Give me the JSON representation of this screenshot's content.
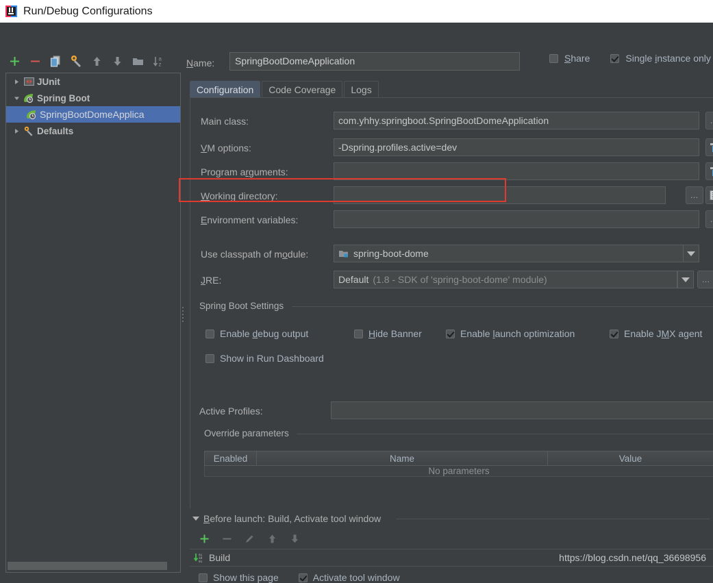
{
  "window": {
    "title": "Run/Debug Configurations",
    "logo_icon": "intellij-idea-logo"
  },
  "toolbar": {
    "buttons": [
      {
        "name": "add",
        "icon": "plus-icon",
        "label": "+"
      },
      {
        "name": "remove",
        "icon": "minus-icon",
        "label": "−"
      },
      {
        "name": "copy",
        "icon": "copy-icon",
        "label": ""
      },
      {
        "name": "edit-templates",
        "icon": "wrench-icon",
        "label": ""
      },
      {
        "name": "move-up",
        "icon": "arrow-up-icon",
        "label": ""
      },
      {
        "name": "move-down",
        "icon": "arrow-down-icon",
        "label": ""
      },
      {
        "name": "new-folder",
        "icon": "folder-icon",
        "label": ""
      },
      {
        "name": "sort-alphabetically",
        "icon": "sort-az-icon",
        "label": ""
      }
    ]
  },
  "tree": {
    "items": [
      {
        "label": "JUnit",
        "icon": "junit-icon",
        "expanded": false,
        "selected": false,
        "child": false
      },
      {
        "label": "Spring Boot",
        "icon": "spring-boot-icon",
        "expanded": true,
        "selected": false,
        "child": false
      },
      {
        "label": "SpringBootDomeApplica",
        "icon": "spring-boot-icon",
        "expanded": null,
        "selected": true,
        "child": true
      },
      {
        "label": "Defaults",
        "icon": "wrench-icon",
        "expanded": false,
        "selected": false,
        "child": false
      }
    ]
  },
  "header": {
    "name_label": "Name:",
    "name_value": "SpringBootDomeApplication",
    "share_label": "Share",
    "share_checked": false,
    "single_instance_label": "Single instance only",
    "single_instance_checked": true
  },
  "tabs": [
    {
      "label": "Configuration",
      "active": true
    },
    {
      "label": "Code Coverage",
      "active": false
    },
    {
      "label": "Logs",
      "active": false
    }
  ],
  "fields": {
    "main_class_label": "Main class:",
    "main_class_value": "com.yhhy.springboot.SpringBootDomeApplication",
    "vm_options_label": "VM options:",
    "vm_options_value": "-Dspring.profiles.active=dev",
    "program_arguments_label": "Program arguments:",
    "program_arguments_value": "",
    "working_directory_label": "Working directory:",
    "working_directory_value": "",
    "environment_variables_label": "Environment variables:",
    "environment_variables_value": "",
    "classpath_label": "Use classpath of module:",
    "classpath_value": "spring-boot-dome",
    "classpath_icon": "module-icon",
    "jre_label": "JRE:",
    "jre_value": "Default",
    "jre_hint": "(1.8 - SDK of 'spring-boot-dome' module)",
    "ellipsis": "…"
  },
  "spring_settings": {
    "group_title": "Spring Boot Settings",
    "checkboxes": [
      {
        "label": "Enable debug output",
        "checked": false
      },
      {
        "label": "Hide Banner",
        "checked": false
      },
      {
        "label": "Enable launch optimization",
        "checked": true
      },
      {
        "label": "Enable JMX agent",
        "checked": true
      },
      {
        "label": "Show in Run Dashboard",
        "checked": false
      }
    ],
    "active_profiles_label": "Active Profiles:",
    "active_profiles_value": ""
  },
  "override_parameters": {
    "group_title": "Override parameters",
    "columns": [
      "Enabled",
      "Name",
      "Value"
    ],
    "empty_text": "No parameters",
    "more_button": "»"
  },
  "before_launch": {
    "title": "Before launch: Build, Activate tool window",
    "toolbar": [
      {
        "name": "add",
        "icon": "plus-icon"
      },
      {
        "name": "remove",
        "icon": "minus-icon"
      },
      {
        "name": "edit",
        "icon": "pencil-icon"
      },
      {
        "name": "move-up",
        "icon": "arrow-up-icon"
      },
      {
        "name": "move-down",
        "icon": "arrow-down-icon"
      }
    ],
    "tasks": [
      {
        "label": "Build",
        "icon": "build-icon"
      }
    ],
    "show_page_label": "Show this page",
    "show_page_checked": false,
    "activate_tool_window_label": "Activate tool window",
    "activate_tool_window_checked": true
  },
  "watermark": "https://blog.csdn.net/qq_36698956",
  "colors": {
    "accent_selection": "#4b6eaf",
    "highlight_box": "#e03a2f",
    "background": "#3c3f41",
    "field_background": "#45494a"
  }
}
